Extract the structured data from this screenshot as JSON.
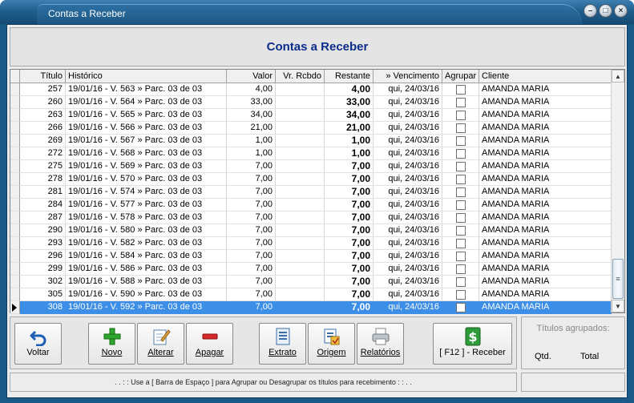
{
  "window": {
    "title": "Contas a Receber"
  },
  "header": {
    "title": "Contas a Receber"
  },
  "grid": {
    "columns": [
      "Título",
      "Histórico",
      "Valor",
      "Vr. Rcbdo",
      "Restante",
      "» Vencimento",
      "Agrupar",
      "Cliente"
    ],
    "rows": [
      {
        "titulo": "257",
        "historico": "19/01/16 - V. 563 » Parc. 03 de 03",
        "valor": "4,00",
        "rcbdo": "",
        "restante": "4,00",
        "vencimento": "qui, 24/03/16",
        "cliente": "AMANDA MARIA"
      },
      {
        "titulo": "260",
        "historico": "19/01/16 - V. 564 » Parc. 03 de 03",
        "valor": "33,00",
        "rcbdo": "",
        "restante": "33,00",
        "vencimento": "qui, 24/03/16",
        "cliente": "AMANDA MARIA"
      },
      {
        "titulo": "263",
        "historico": "19/01/16 - V. 565 » Parc. 03 de 03",
        "valor": "34,00",
        "rcbdo": "",
        "restante": "34,00",
        "vencimento": "qui, 24/03/16",
        "cliente": "AMANDA MARIA"
      },
      {
        "titulo": "266",
        "historico": "19/01/16 - V. 566 » Parc. 03 de 03",
        "valor": "21,00",
        "rcbdo": "",
        "restante": "21,00",
        "vencimento": "qui, 24/03/16",
        "cliente": "AMANDA MARIA"
      },
      {
        "titulo": "269",
        "historico": "19/01/16 - V. 567 » Parc. 03 de 03",
        "valor": "1,00",
        "rcbdo": "",
        "restante": "1,00",
        "vencimento": "qui, 24/03/16",
        "cliente": "AMANDA MARIA"
      },
      {
        "titulo": "272",
        "historico": "19/01/16 - V. 568 » Parc. 03 de 03",
        "valor": "1,00",
        "rcbdo": "",
        "restante": "1,00",
        "vencimento": "qui, 24/03/16",
        "cliente": "AMANDA MARIA"
      },
      {
        "titulo": "275",
        "historico": "19/01/16 - V. 569 » Parc. 03 de 03",
        "valor": "7,00",
        "rcbdo": "",
        "restante": "7,00",
        "vencimento": "qui, 24/03/16",
        "cliente": "AMANDA MARIA"
      },
      {
        "titulo": "278",
        "historico": "19/01/16 - V. 570 » Parc. 03 de 03",
        "valor": "7,00",
        "rcbdo": "",
        "restante": "7,00",
        "vencimento": "qui, 24/03/16",
        "cliente": "AMANDA MARIA"
      },
      {
        "titulo": "281",
        "historico": "19/01/16 - V. 574 » Parc. 03 de 03",
        "valor": "7,00",
        "rcbdo": "",
        "restante": "7,00",
        "vencimento": "qui, 24/03/16",
        "cliente": "AMANDA MARIA"
      },
      {
        "titulo": "284",
        "historico": "19/01/16 - V. 577 » Parc. 03 de 03",
        "valor": "7,00",
        "rcbdo": "",
        "restante": "7,00",
        "vencimento": "qui, 24/03/16",
        "cliente": "AMANDA MARIA"
      },
      {
        "titulo": "287",
        "historico": "19/01/16 - V. 578 » Parc. 03 de 03",
        "valor": "7,00",
        "rcbdo": "",
        "restante": "7,00",
        "vencimento": "qui, 24/03/16",
        "cliente": "AMANDA MARIA"
      },
      {
        "titulo": "290",
        "historico": "19/01/16 - V. 580 » Parc. 03 de 03",
        "valor": "7,00",
        "rcbdo": "",
        "restante": "7,00",
        "vencimento": "qui, 24/03/16",
        "cliente": "AMANDA MARIA"
      },
      {
        "titulo": "293",
        "historico": "19/01/16 - V. 582 » Parc. 03 de 03",
        "valor": "7,00",
        "rcbdo": "",
        "restante": "7,00",
        "vencimento": "qui, 24/03/16",
        "cliente": "AMANDA MARIA"
      },
      {
        "titulo": "296",
        "historico": "19/01/16 - V. 584 » Parc. 03 de 03",
        "valor": "7,00",
        "rcbdo": "",
        "restante": "7,00",
        "vencimento": "qui, 24/03/16",
        "cliente": "AMANDA MARIA"
      },
      {
        "titulo": "299",
        "historico": "19/01/16 - V. 586 » Parc. 03 de 03",
        "valor": "7,00",
        "rcbdo": "",
        "restante": "7,00",
        "vencimento": "qui, 24/03/16",
        "cliente": "AMANDA MARIA"
      },
      {
        "titulo": "302",
        "historico": "19/01/16 - V. 588 » Parc. 03 de 03",
        "valor": "7,00",
        "rcbdo": "",
        "restante": "7,00",
        "vencimento": "qui, 24/03/16",
        "cliente": "AMANDA MARIA"
      },
      {
        "titulo": "305",
        "historico": "19/01/16 - V. 590 » Parc. 03 de 03",
        "valor": "7,00",
        "rcbdo": "",
        "restante": "7,00",
        "vencimento": "qui, 24/03/16",
        "cliente": "AMANDA MARIA"
      },
      {
        "titulo": "308",
        "historico": "19/01/16 - V. 592 » Parc. 03 de 03",
        "valor": "7,00",
        "rcbdo": "",
        "restante": "7,00",
        "vencimento": "qui, 24/03/16",
        "cliente": "AMANDA MARIA",
        "selected": true
      }
    ]
  },
  "toolbar": {
    "buttons": [
      {
        "id": "voltar",
        "label": "Voltar",
        "icon": "undo-arrow-icon"
      },
      {
        "id": "novo",
        "label": "Novo",
        "icon": "plus-icon"
      },
      {
        "id": "alterar",
        "label": "Alterar",
        "icon": "edit-pencil-icon"
      },
      {
        "id": "apagar",
        "label": "Apagar",
        "icon": "minus-icon"
      },
      {
        "id": "extrato",
        "label": "Extrato",
        "icon": "document-icon"
      },
      {
        "id": "origem",
        "label": "Origem",
        "icon": "report-icon"
      },
      {
        "id": "relatorios",
        "label": "Relatórios",
        "icon": "printer-icon"
      },
      {
        "id": "receber",
        "label": "[ F12 ] - Receber",
        "icon": "dollar-icon"
      }
    ]
  },
  "grouped": {
    "title": "Títulos agrupados:",
    "qtd_label": "Qtd.",
    "total_label": "Total"
  },
  "status": {
    "hint": ". . : :    Use a [ Barra de Espaço ] para Agrupar ou Desagrupar os títulos para recebimento    : : . ."
  },
  "colors": {
    "titlebar": "#1f5f8f",
    "header_title": "#0b2c8a",
    "selection": "#3d8ee6"
  }
}
